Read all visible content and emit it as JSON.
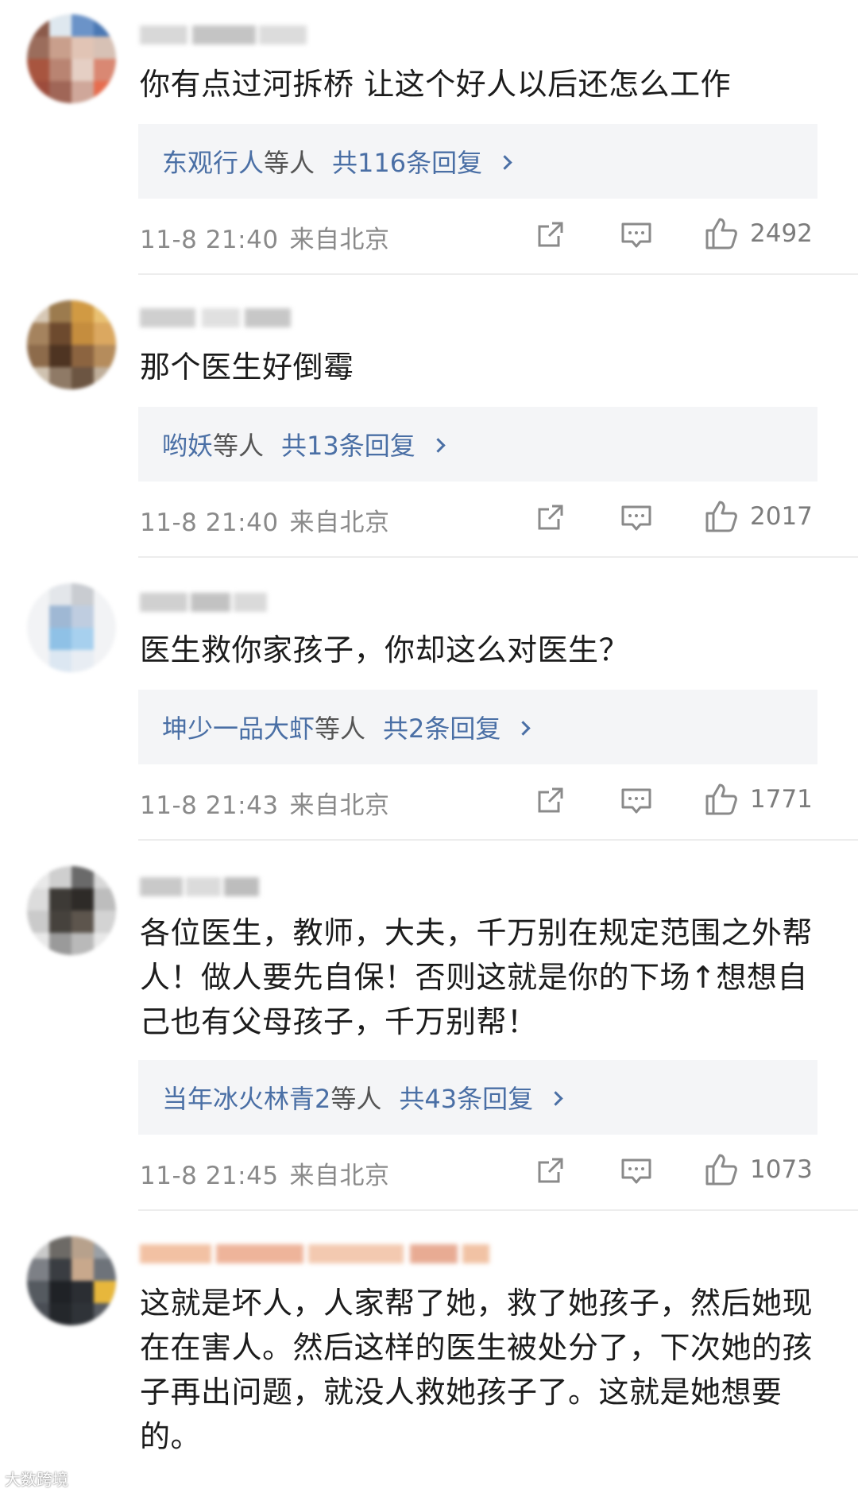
{
  "comments": [
    {
      "text": "你有点过河拆桥 让这个好人以后还怎么工作",
      "reply_names": "东观行人",
      "reply_etc": "等人",
      "reply_count": "共116条回复",
      "time": "11-8 21:40",
      "location": "来自北京",
      "likes": "2492"
    },
    {
      "text": "那个医生好倒霉",
      "reply_names": "哟妖",
      "reply_etc": "等人",
      "reply_count": "共13条回复",
      "time": "11-8 21:40",
      "location": "来自北京",
      "likes": "2017"
    },
    {
      "text": "医生救你家孩子，你却这么对医生？",
      "reply_names": "坤少一品大虾",
      "reply_etc": "等人",
      "reply_count": "共2条回复",
      "time": "11-8 21:43",
      "location": "来自北京",
      "likes": "1771"
    },
    {
      "text": "各位医生，教师，大夫，千万别在规定范围之外帮人！做人要先自保！否则这就是你的下场↑想想自己也有父母孩子，千万别帮！",
      "reply_names": "当年冰火林青2",
      "reply_etc": "等人",
      "reply_count": "共43条回复",
      "time": "11-8 21:45",
      "location": "来自北京",
      "likes": "1073"
    },
    {
      "text": "这就是坏人，人家帮了她，救了她孩子，然后她现在在害人。然后这样的医生被处分了，下次她的孩子再出问题，就没人救她孩子了。这就是她想要的。"
    }
  ],
  "icons": {
    "repost": "repost-icon",
    "comment": "comment-icon",
    "like": "like-icon"
  },
  "watermark": "大数跨境",
  "colors": {
    "link": "#4a6fa5",
    "meta": "#8a8a8a",
    "reply_bg": "#f4f5f7"
  }
}
